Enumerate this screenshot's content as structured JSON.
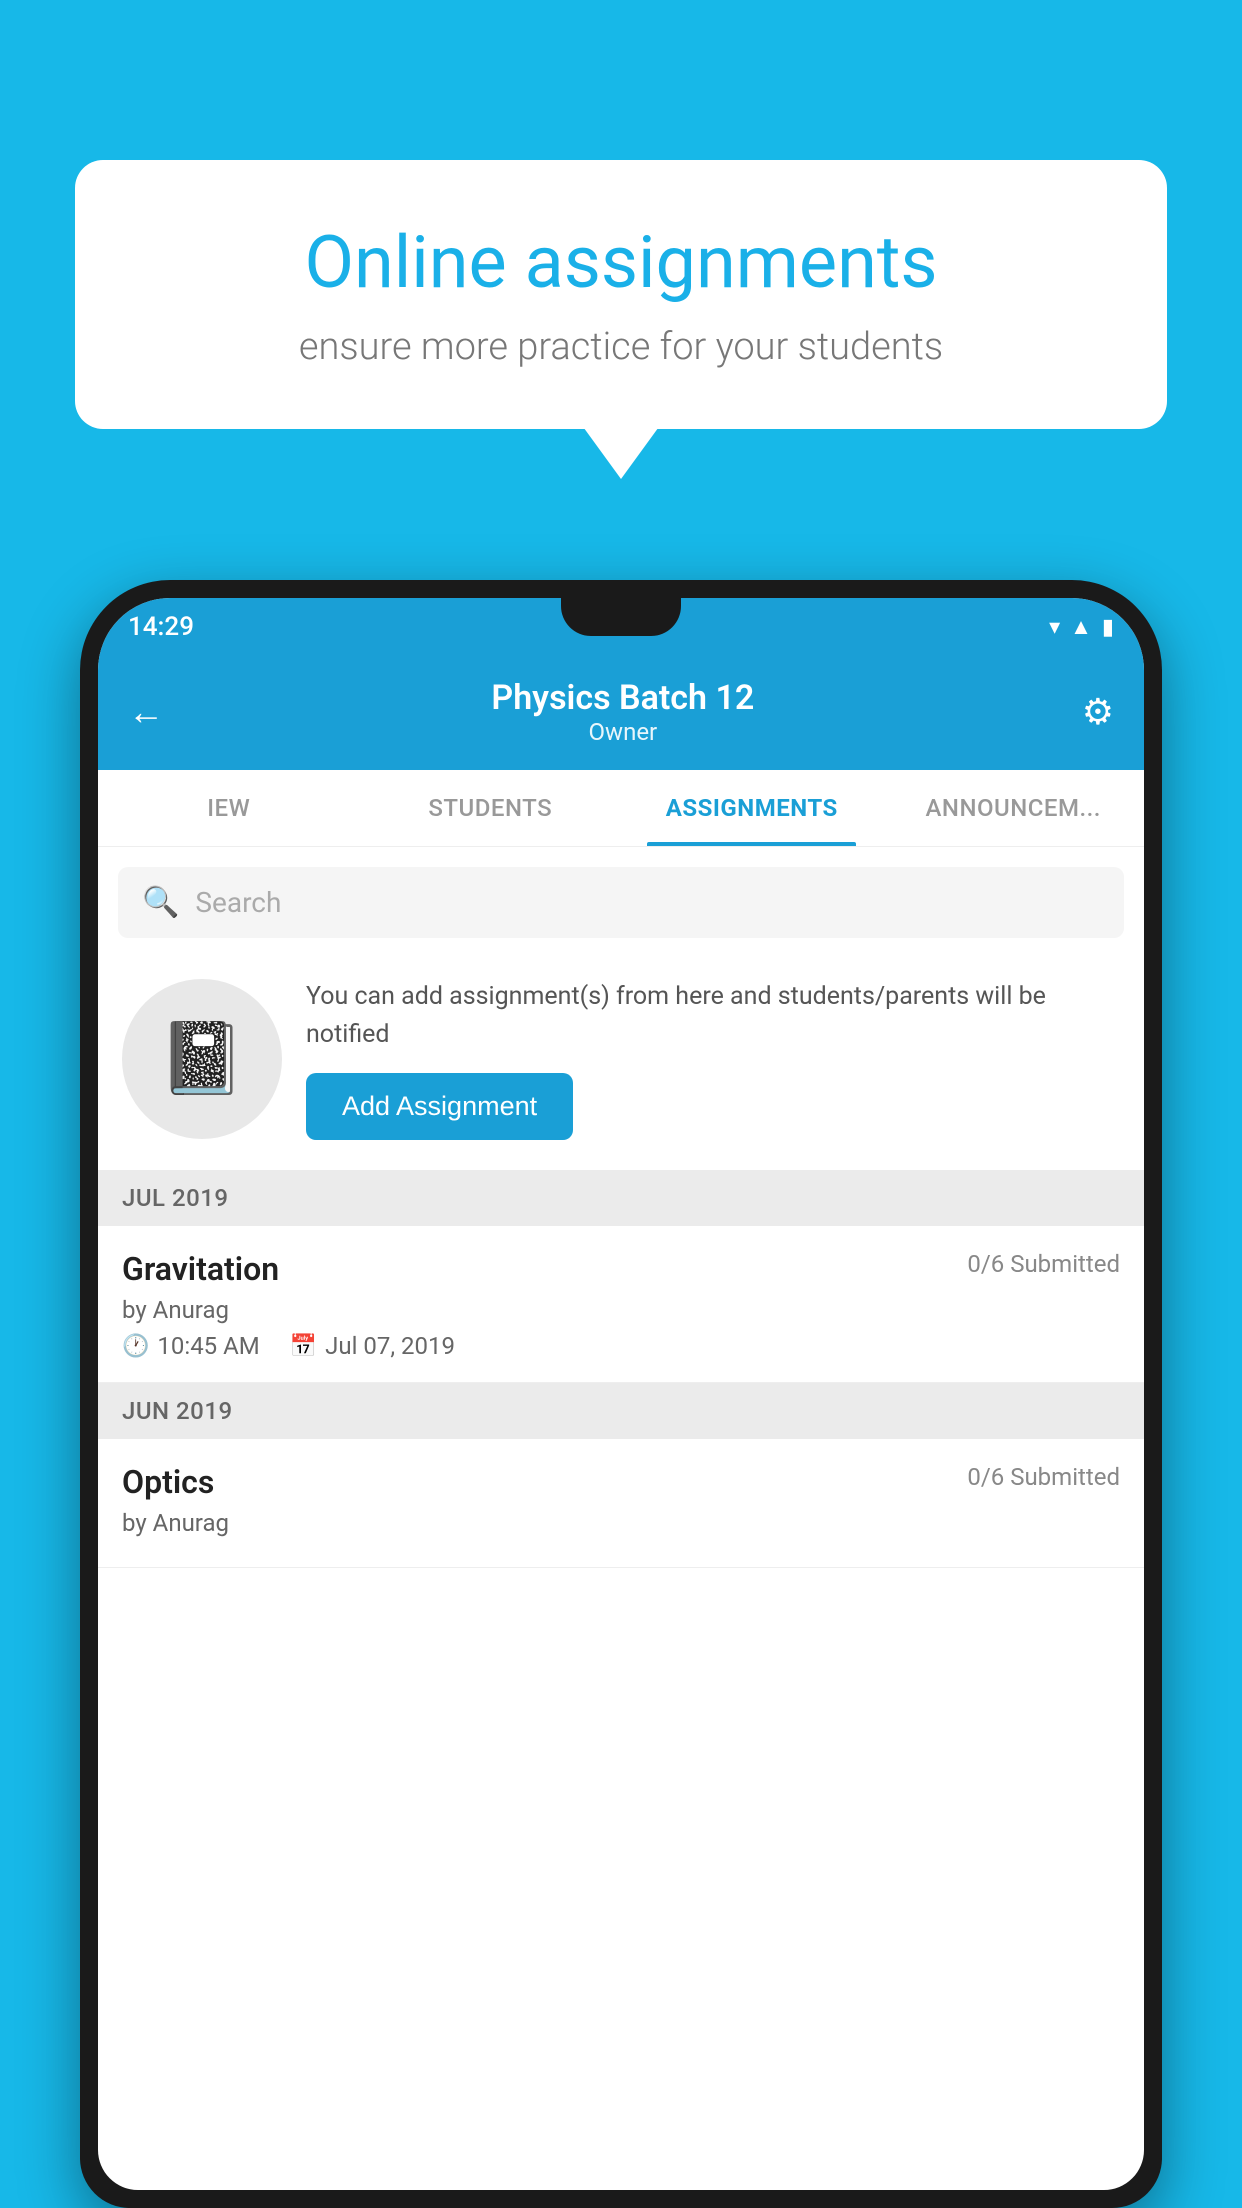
{
  "background": {
    "color": "#17b8e8"
  },
  "speech_bubble": {
    "title": "Online assignments",
    "subtitle": "ensure more practice for your students"
  },
  "status_bar": {
    "time": "14:29",
    "icons": [
      "wifi",
      "signal",
      "battery"
    ]
  },
  "app_header": {
    "title": "Physics Batch 12",
    "subtitle": "Owner",
    "back_label": "←",
    "settings_label": "⚙"
  },
  "tabs": [
    {
      "label": "IEW",
      "active": false
    },
    {
      "label": "STUDENTS",
      "active": false
    },
    {
      "label": "ASSIGNMENTS",
      "active": true
    },
    {
      "label": "ANNOUNCEM...",
      "active": false
    }
  ],
  "search": {
    "placeholder": "Search"
  },
  "add_assignment_section": {
    "info_text": "You can add assignment(s) from here and students/parents will be notified",
    "button_label": "Add Assignment"
  },
  "assignment_groups": [
    {
      "month": "JUL 2019",
      "assignments": [
        {
          "name": "Gravitation",
          "submitted": "0/6 Submitted",
          "by": "by Anurag",
          "time": "10:45 AM",
          "date": "Jul 07, 2019"
        }
      ]
    },
    {
      "month": "JUN 2019",
      "assignments": [
        {
          "name": "Optics",
          "submitted": "0/6 Submitted",
          "by": "by Anurag",
          "time": "",
          "date": ""
        }
      ]
    }
  ]
}
